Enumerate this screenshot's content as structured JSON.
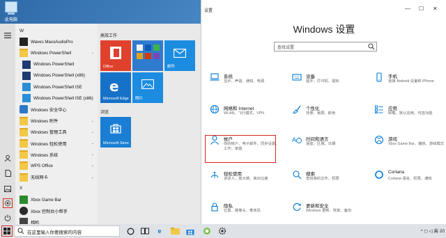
{
  "desktop": {
    "icon_label": "此电脑"
  },
  "start_menu": {
    "apps": [
      {
        "kind": "letter",
        "label": "W"
      },
      {
        "kind": "app",
        "label": "Waves MaxxAudioPro",
        "icon": "waves-icon",
        "expand": false
      },
      {
        "kind": "folder",
        "label": "Windows PowerShell",
        "icon": "folder-icon",
        "expand": true
      },
      {
        "kind": "sub",
        "label": "Windows PowerShell",
        "icon": "powershell-icon",
        "expand": false
      },
      {
        "kind": "sub",
        "label": "Windows PowerShell (x86)",
        "icon": "powershell-icon",
        "expand": false
      },
      {
        "kind": "sub",
        "label": "Windows PowerShell ISE",
        "icon": "powershell-ise-icon",
        "expand": false
      },
      {
        "kind": "sub",
        "label": "Windows PowerShell ISE (x86)",
        "icon": "powershell-ise-icon",
        "expand": false
      },
      {
        "kind": "app",
        "label": "Windows 安全中心",
        "icon": "shield-icon",
        "expand": false
      },
      {
        "kind": "folder",
        "label": "Windows 附件",
        "icon": "folder-icon",
        "expand": true
      },
      {
        "kind": "folder",
        "label": "Windows 管理工具",
        "icon": "folder-icon",
        "expand": true
      },
      {
        "kind": "folder",
        "label": "Windows 轻松使用",
        "icon": "folder-icon",
        "expand": true
      },
      {
        "kind": "folder",
        "label": "Windows 系统",
        "icon": "folder-icon",
        "expand": true
      },
      {
        "kind": "folder",
        "label": "WPS Office",
        "icon": "folder-icon",
        "expand": true
      },
      {
        "kind": "folder",
        "label": "无线网卡",
        "icon": "folder-icon",
        "expand": true
      },
      {
        "kind": "letter",
        "label": "X"
      },
      {
        "kind": "app",
        "label": "Xbox Game Bar",
        "icon": "xbox-game-bar-icon",
        "expand": false
      },
      {
        "kind": "app",
        "label": "Xbox 控制台小帮手",
        "icon": "xbox-icon",
        "expand": false
      },
      {
        "kind": "app",
        "label": "相机",
        "icon": "camera-icon",
        "expand": false
      }
    ],
    "groups": {
      "productivity": "高效工作",
      "browse": "浏览"
    },
    "tiles": {
      "office": "Office",
      "mail": "邮件",
      "edge": "Microsoft Edge",
      "photos": "照片",
      "store": "Microsoft Store"
    },
    "colors": {
      "office_tile": "#e0412d",
      "mixed_tile": "#2f7bd0",
      "mail_tile": "#1c8ce0",
      "edge_tile": "#1672c8",
      "photos_tile": "#1c8ce0",
      "store_tile": "#1a7fd4"
    }
  },
  "settings": {
    "window_title": "设置",
    "heading": "Windows 设置",
    "search_placeholder": "查找设置",
    "categories": [
      {
        "title": "系统",
        "desc": "显示、声音、通知、电源",
        "icon": "laptop-icon"
      },
      {
        "title": "设备",
        "desc": "蓝牙、打印机、鼠标",
        "icon": "keyboard-icon"
      },
      {
        "title": "手机",
        "desc": "连接 Android 设备和 iPhone",
        "icon": "phone-icon"
      },
      {
        "title": "网络和 Internet",
        "desc": "WLAN、飞行模式、VPN",
        "icon": "globe-icon"
      },
      {
        "title": "个性化",
        "desc": "背景、锁屏、颜色",
        "icon": "paint-icon"
      },
      {
        "title": "应用",
        "desc": "卸载、默认应用、可选功能",
        "icon": "apps-icon"
      },
      {
        "title": "帐户",
        "desc": "你的帐户、电子邮件、同步设置、工作、家庭",
        "icon": "person-icon"
      },
      {
        "title": "时间和语言",
        "desc": "语音、区域、日期",
        "icon": "time-language-icon"
      },
      {
        "title": "游戏",
        "desc": "Xbox Game Bar、捕获、游戏模式",
        "icon": "xbox-icon"
      },
      {
        "title": "轻松使用",
        "desc": "讲述人、放大镜、高对比度",
        "icon": "ease-of-access-icon"
      },
      {
        "title": "搜索",
        "desc": "查找我的文件、权限",
        "icon": "search-icon"
      },
      {
        "title": "Cortana",
        "desc": "Cortana 语言、权限、通知",
        "icon": "cortana-icon"
      },
      {
        "title": "隐私",
        "desc": "位置、摄像头、麦克风",
        "icon": "lock-icon"
      },
      {
        "title": "更新和安全",
        "desc": "Windows 更新、恢复、备份",
        "icon": "update-icon"
      }
    ],
    "accent": "#0078d7"
  },
  "taskbar": {
    "search_text": "在这里输入你要搜索的内容",
    "tray_text": "^ ◻ ◁ 英 20"
  },
  "highlight_color": "#d9251d"
}
